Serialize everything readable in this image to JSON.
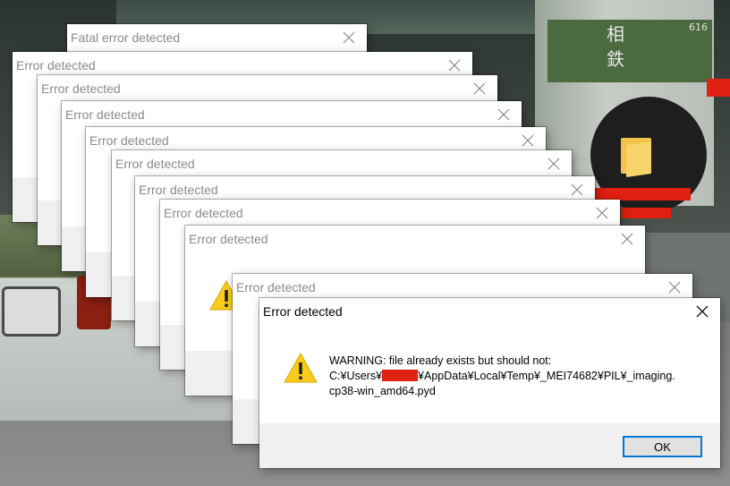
{
  "desktop": {
    "bus_kanji_1": "相",
    "bus_kanji_2": "鉄",
    "bus_number": "616"
  },
  "dialogs": [
    {
      "title": "Fatal error detected"
    },
    {
      "title": "Error detected"
    },
    {
      "title": "Error detected"
    },
    {
      "title": "Error detected"
    },
    {
      "title": "Error detected"
    },
    {
      "title": "Error detected"
    },
    {
      "title": "Error detected"
    },
    {
      "title": "Error detected"
    },
    {
      "title": "Error detected"
    },
    {
      "title": "Error detected"
    }
  ],
  "main_dialog": {
    "title": "Error detected",
    "message_line1": "WARNING: file already exists but should not:",
    "message_line2_prefix": "C:¥Users¥",
    "message_line2_suffix": "¥AppData¥Local¥Temp¥_MEI74682¥PIL¥_imaging.",
    "message_line3": "cp38-win_amd64.pyd",
    "ok_label": "OK"
  },
  "colors": {
    "accent": "#0078d7",
    "warning_icon": "#f7cc1b",
    "redaction": "#e02010"
  },
  "icons": {
    "close": "close-icon",
    "warning": "warning-icon",
    "folder": "folder-icon"
  }
}
